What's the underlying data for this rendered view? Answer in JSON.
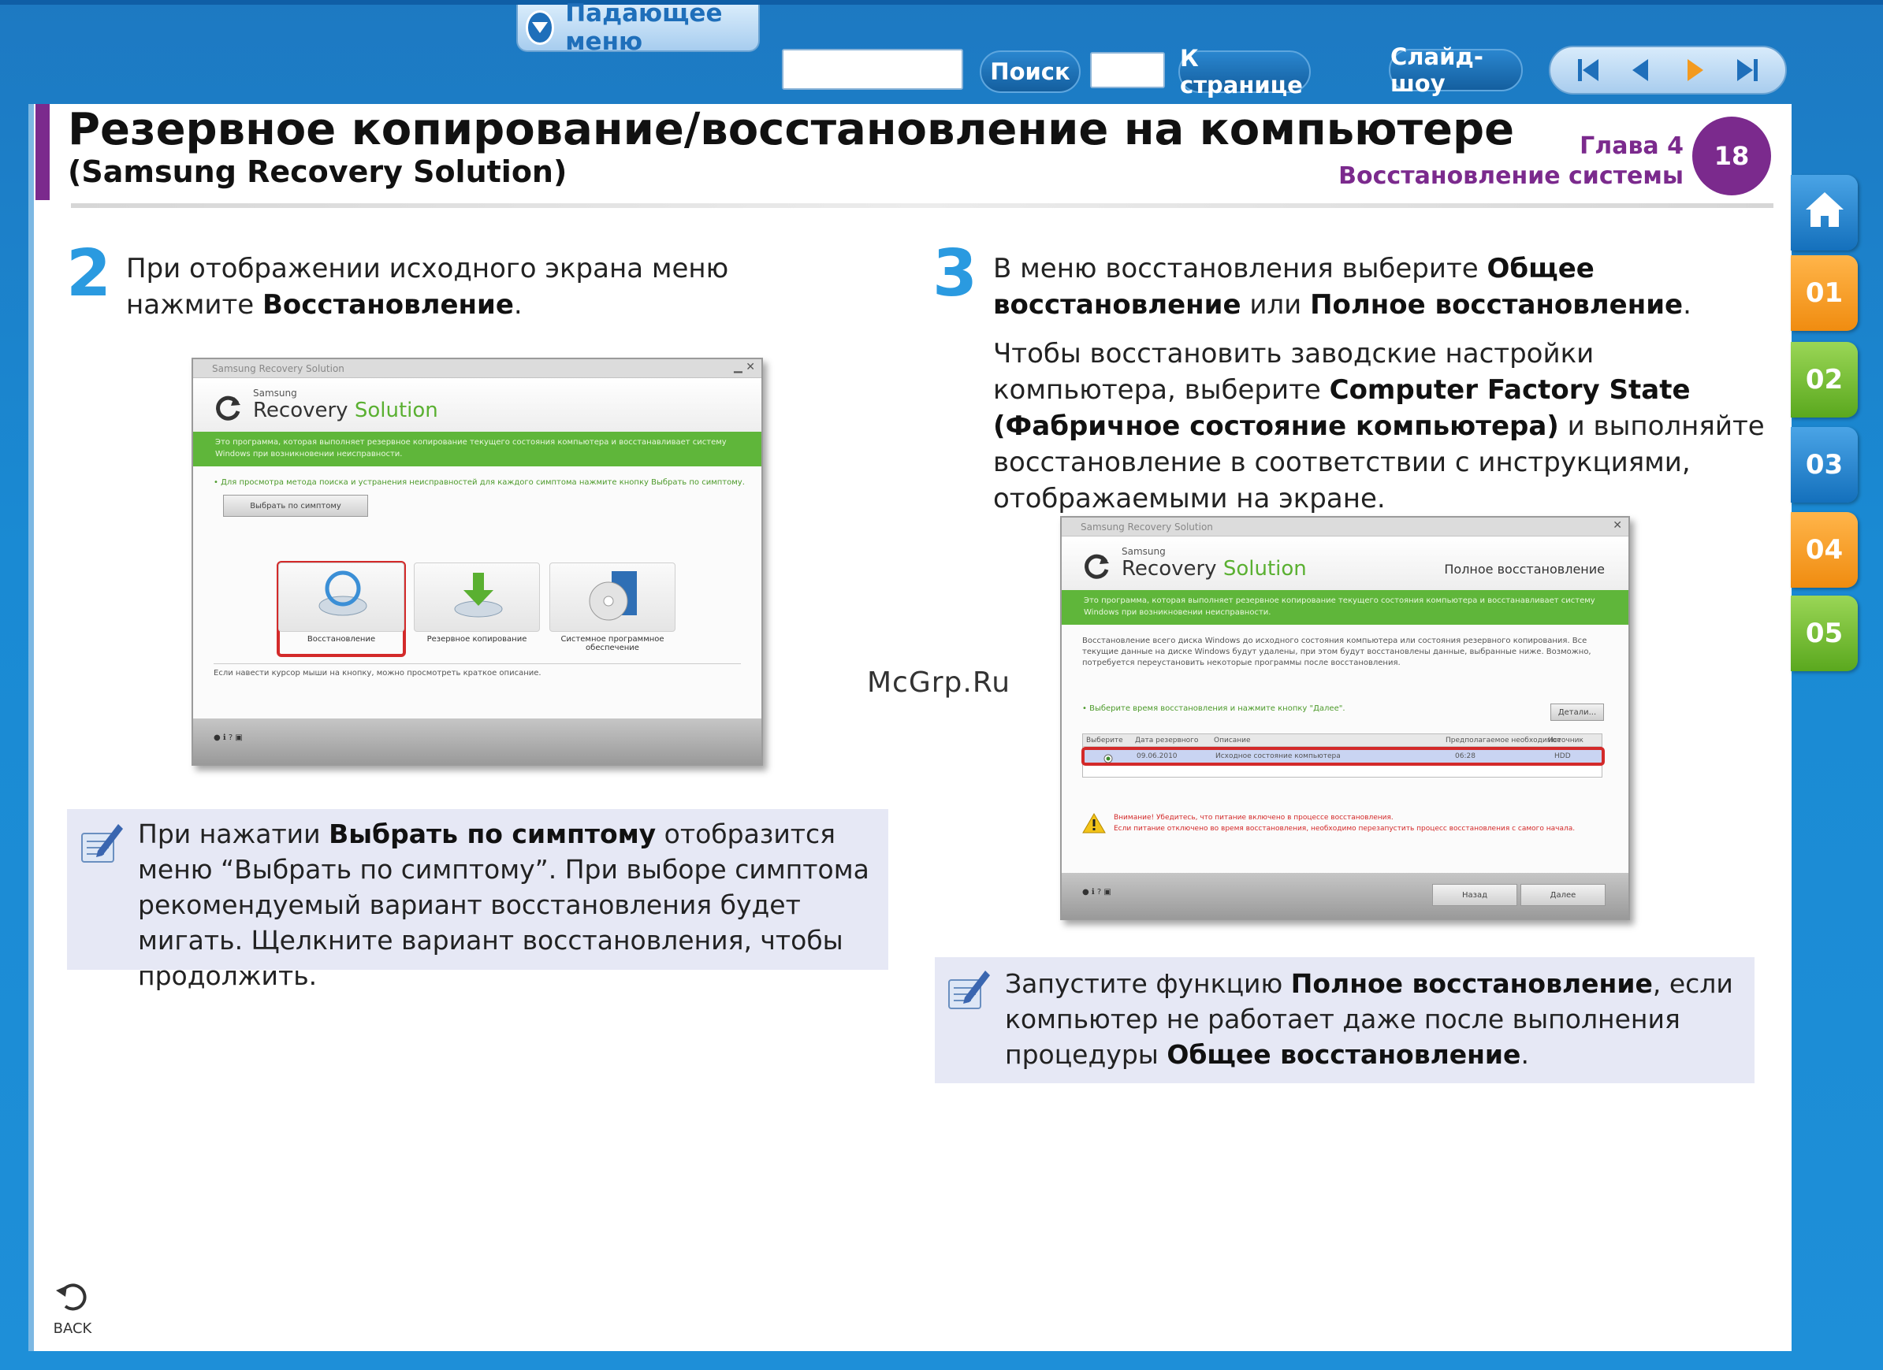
{
  "toolbar": {
    "dropdown_label": "Падающее меню",
    "search_value": "",
    "search_button": "Поиск",
    "page_value": "",
    "page_button": "К странице",
    "slideshow_button": "Слайд-шоу"
  },
  "header": {
    "title_line1": "Резервное копирование/восстановление на компьютере",
    "title_line2": "(Samsung Recovery Solution)",
    "chapter_label": "Глава 4",
    "chapter_name": "Восстановление системы",
    "page_number": "18"
  },
  "side_tabs": [
    "01",
    "02",
    "03",
    "04",
    "05"
  ],
  "step2": {
    "number": "2",
    "text_a": "При отображении исходного экрана меню нажмите ",
    "text_b": "Восстановление",
    "text_c": "."
  },
  "step3": {
    "number": "3",
    "text_a": "В меню восстановления выберите ",
    "text_b": "Общее восстановление",
    "text_c": " или ",
    "text_d": "Полное восстановление",
    "text_e": ".",
    "para_a": "Чтобы восстановить заводские настройки компьютера, выберите ",
    "para_b": "Computer Factory State (Фабричное состояние компьютера)",
    "para_c": " и выполняйте восстановление в соответствии с инструкциями, отображаемыми на экране."
  },
  "window1": {
    "title": "Samsung Recovery Solution",
    "logo_small": "Samsung",
    "logo_big_a": "Recovery",
    "logo_big_b": " Solution",
    "green_text": "Это программа, которая выполняет резервное копирование текущего состояния компьютера и восстанавливает систему Windows при возникновении неисправности.",
    "hint": "• Для просмотра метода поиска и устранения неисправностей для каждого симптома нажмите кнопку Выбрать по симптому.",
    "symptom_button": "Выбрать по симптому",
    "options": [
      "Восстановление",
      "Резервное копирование",
      "Системное программное обеспечение"
    ],
    "footer_note": "Если навести курсор мыши на кнопку, можно просмотреть краткое описание."
  },
  "window2": {
    "title": "Samsung Recovery Solution",
    "logo_small": "Samsung",
    "logo_big_a": "Recovery",
    "logo_big_b": " Solution",
    "heading": "Полное восстановление",
    "green_text": "Это программа, которая выполняет резервное копирование текущего состояния компьютера и восстанавливает систему Windows при возникновении неисправности.",
    "desc": "Восстановление всего диска Windows до исходного состояния компьютера или состояния резервного копирования. Все текущие данные на диске Windows будут удалены, при этом будут восстановлены данные, выбранные ниже. Возможно, потребуется переустановить некоторые программы после восстановления.",
    "hint": "• Выберите время восстановления и нажмите кнопку \"Далее\".",
    "details_button": "Детали...",
    "columns": [
      "Выберите",
      "Дата резервного",
      "Описание",
      "Предполагаемое необходимое",
      "Источник"
    ],
    "row": [
      "",
      "09.06.2010",
      "Исходное состояние компьютера",
      "06:28",
      "HDD"
    ],
    "warning_a": "Внимание! Убедитесь, что питание включено в процессе восстановления.",
    "warning_b": "Если питание отключено во время восстановления, необходимо перезапустить процесс восстановления с самого начала.",
    "back_button": "Назад",
    "next_button": "Далее"
  },
  "note1": {
    "a": "При нажатии ",
    "b": "Выбрать по симптому",
    "c": " отобразится меню “Выбрать по симптому”. При выборе симптома рекомендуемый вариант восстановления будет мигать. Щелкните вариант восстановления, чтобы продолжить."
  },
  "note2": {
    "a": "Запустите функцию ",
    "b": "Полное восстановление",
    "c": ", если компьютер не работает даже после выполнения процедуры ",
    "d": "Общее восстановление",
    "e": "."
  },
  "watermark": "McGrp.Ru",
  "back_label": "BACK",
  "colors": {
    "accent_purple": "#7b2a8d",
    "step_blue": "#2a9ae0",
    "app_green": "#5fb63a",
    "highlight_red": "#d32a2a"
  }
}
